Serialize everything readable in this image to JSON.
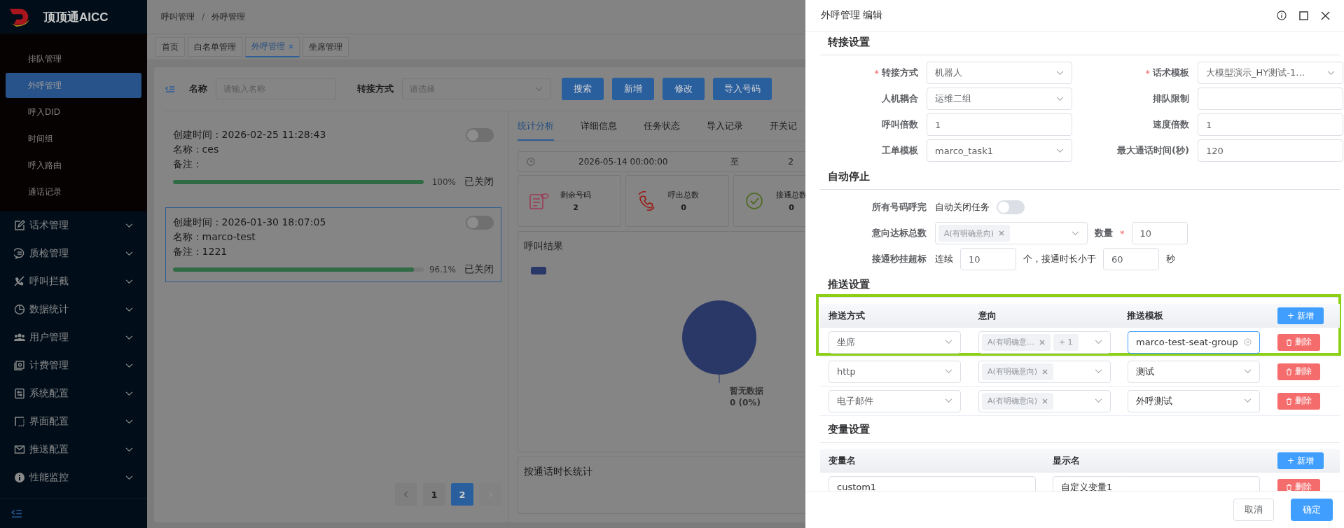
{
  "app": {
    "logo": "顶顶通AICC"
  },
  "sidebar": {
    "submenu": [
      {
        "label": "排队管理",
        "selected": false
      },
      {
        "label": "外呼管理",
        "selected": true
      },
      {
        "label": "呼入DID",
        "selected": false
      },
      {
        "label": "时间组",
        "selected": false
      },
      {
        "label": "呼入路由",
        "selected": false
      },
      {
        "label": "通话记录",
        "selected": false
      }
    ],
    "groups": [
      {
        "label": "话术管理",
        "expanded": false
      },
      {
        "label": "质检管理",
        "expanded": false
      },
      {
        "label": "呼叫拦截",
        "expanded": false
      },
      {
        "label": "数据统计",
        "expanded": false
      },
      {
        "label": "用户管理",
        "expanded": false
      },
      {
        "label": "计费管理",
        "expanded": false
      },
      {
        "label": "系统配置",
        "expanded": false
      },
      {
        "label": "界面配置",
        "expanded": false
      },
      {
        "label": "推送配置",
        "expanded": false
      },
      {
        "label": "性能监控",
        "expanded": false
      }
    ]
  },
  "breadcrumb": {
    "items": [
      "呼叫管理",
      "外呼管理"
    ],
    "separator": "/"
  },
  "tabs": [
    {
      "label": "首页",
      "selected": false,
      "closable": false
    },
    {
      "label": "白名单管理",
      "selected": false,
      "closable": false
    },
    {
      "label": "外呼管理",
      "selected": true,
      "closable": true
    },
    {
      "label": "坐席管理",
      "selected": false,
      "closable": false
    }
  ],
  "filters": [
    {
      "label": "名称",
      "placeholder": "请输入名称",
      "kind": "input"
    },
    {
      "label": "转接方式",
      "placeholder": "请选择",
      "kind": "select"
    }
  ],
  "toolbar_buttons": [
    "搜索",
    "新增",
    "修改",
    "导入号码"
  ],
  "tasks": [
    {
      "created": "创建时间 : 2026-02-25 11:28:43",
      "name": "名称 : ces",
      "note": "备注 :",
      "level": 1,
      "percent": "100%",
      "status": "已关闭",
      "on": false,
      "selected": false
    },
    {
      "created": "创建时间 : 2026-01-30 18:07:05",
      "name": "名称 : marco-test",
      "note": "备注 : 1221",
      "level": 0.961,
      "percent": "96.1%",
      "status": "已关闭",
      "on": false,
      "selected": true
    }
  ],
  "pagination": [
    {
      "label": "1",
      "selected": false
    },
    {
      "label": "2",
      "selected": true
    }
  ],
  "detail_tabs": [
    {
      "label": "统计分析",
      "selected": true
    },
    {
      "label": "详细信息",
      "selected": false
    },
    {
      "label": "任务状态",
      "selected": false
    },
    {
      "label": "导入记录",
      "selected": false
    },
    {
      "label": "开关记",
      "selected": false
    }
  ],
  "date_range": {
    "start": "2026-05-14 00:00:00",
    "separator": "至",
    "end": "2"
  },
  "stat_cards": [
    {
      "label": "剩余号码",
      "value": "2",
      "kind": "list"
    },
    {
      "label": "呼出总数",
      "value": "0",
      "kind": "calls"
    },
    {
      "label": "接通总数",
      "value": "0",
      "kind": "connected"
    }
  ],
  "call_result": {
    "title": "呼叫结果",
    "slice_label": "暂无数据",
    "slice_value": "0 (0%)"
  },
  "duration_stats": {
    "title": "按通话时长统计"
  },
  "drawer": {
    "title": "外呼管理 编辑",
    "required_mark": "*",
    "transfer": {
      "title": "转接设置",
      "fields": [
        {
          "label": "转接方式",
          "required": true,
          "value": "机器人",
          "kind": "select"
        },
        {
          "label": "话术模板",
          "required": true,
          "value": "大模型演示_HY测试-1…",
          "kind": "select"
        },
        {
          "label": "人机耦合",
          "required": false,
          "value": "运维二组",
          "kind": "select"
        },
        {
          "label": "排队限制",
          "required": false,
          "kind": "input"
        },
        {
          "label": "呼叫倍数",
          "required": false,
          "value": "1",
          "kind": "input"
        },
        {
          "label": "速度倍数",
          "required": false,
          "value": "1",
          "kind": "input"
        },
        {
          "label": "工单模板",
          "required": false,
          "value": "marco_task1",
          "kind": "select"
        },
        {
          "label": "最大通话时间(秒)",
          "required": false,
          "value": "120",
          "kind": "input"
        }
      ]
    },
    "auto_stop": {
      "title": "自动停止",
      "all_done": {
        "label": "所有号码呼完",
        "text": "自动关闭任务",
        "on": false
      },
      "intent": {
        "label": "意向达标总数",
        "tag": "A(有明确意向)",
        "count_label": "数量",
        "count_required": true,
        "count": "10"
      },
      "short_calls": {
        "label": "接通秒挂超标",
        "prefix": "连续",
        "count": "10",
        "middle": "个，接通时长小于",
        "seconds": "60",
        "suffix": "秒"
      }
    },
    "push": {
      "title": "推送设置",
      "columns": [
        "推送方式",
        "意向",
        "推送模板"
      ],
      "add_button": "+ 新增",
      "highlighted": true,
      "rows": [
        {
          "method": "坐席",
          "tag": "A(有明确意…",
          "more": "+ 1",
          "template": "marco-test-seat-group",
          "kind": "input",
          "focused": true,
          "delete": "删除"
        },
        {
          "method": "http",
          "tag": "A(有明确意向)",
          "template": "测试",
          "kind": "select",
          "focused": false,
          "delete": "删除"
        },
        {
          "method": "电子邮件",
          "tag": "A(有明确意向)",
          "template": "外呼测试",
          "kind": "select",
          "focused": false,
          "delete": "删除"
        }
      ]
    },
    "variables": {
      "title": "变量设置",
      "columns": [
        "变量名",
        "显示名"
      ],
      "add_button": "+ 新增",
      "rows": [
        {
          "name": "custom1",
          "display": "自定义变量1",
          "delete": "删除"
        }
      ]
    },
    "cancel": "取消",
    "confirm": "确定"
  }
}
